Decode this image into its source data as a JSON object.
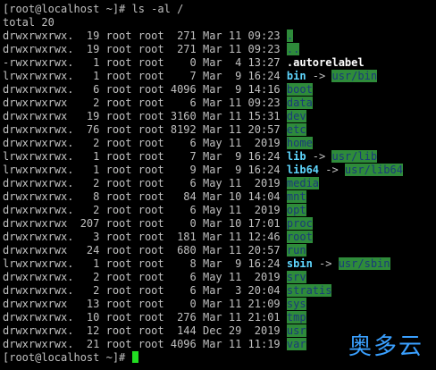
{
  "prompt1": "[root@localhost ~]# ls -al /",
  "total": "total 20",
  "rows": [
    {
      "meta": "drwxrwxrwx.  19 root root  271 Mar 11 09:23 ",
      "name": ".",
      "kind": "dir"
    },
    {
      "meta": "drwxrwxrwx.  19 root root  271 Mar 11 09:23 ",
      "name": "..",
      "kind": "dir"
    },
    {
      "meta": "-rwxrwxrwx.   1 root root    0 Mar  4 13:27 ",
      "name": ".autorelabel",
      "kind": "file"
    },
    {
      "meta": "lrwxrwxrwx.   1 root root    7 Mar  9 16:24 ",
      "name": "bin",
      "kind": "link",
      "target": "usr/bin"
    },
    {
      "meta": "drwxrwxrwx.   6 root root 4096 Mar  9 14:16 ",
      "name": "boot",
      "kind": "dir"
    },
    {
      "meta": "drwxrwxrwx    2 root root    6 Mar 11 09:23 ",
      "name": "data",
      "kind": "dir"
    },
    {
      "meta": "drwxrwxrwx   19 root root 3160 Mar 11 15:31 ",
      "name": "dev",
      "kind": "dir"
    },
    {
      "meta": "drwxrwxrwx.  76 root root 8192 Mar 11 20:57 ",
      "name": "etc",
      "kind": "dir"
    },
    {
      "meta": "drwxrwxrwx.   2 root root    6 May 11  2019 ",
      "name": "home",
      "kind": "dir"
    },
    {
      "meta": "lrwxrwxrwx.   1 root root    7 Mar  9 16:24 ",
      "name": "lib",
      "kind": "link",
      "target": "usr/lib"
    },
    {
      "meta": "lrwxrwxrwx.   1 root root    9 Mar  9 16:24 ",
      "name": "lib64",
      "kind": "link",
      "target": "usr/lib64"
    },
    {
      "meta": "drwxrwxrwx.   2 root root    6 May 11  2019 ",
      "name": "media",
      "kind": "dir"
    },
    {
      "meta": "drwxrwxrwx.   8 root root   84 Mar 10 14:04 ",
      "name": "mnt",
      "kind": "dir"
    },
    {
      "meta": "drwxrwxrwx.   2 root root    6 May 11  2019 ",
      "name": "opt",
      "kind": "dir"
    },
    {
      "meta": "drwxrwxrwx  207 root root    0 Mar 10 17:01 ",
      "name": "proc",
      "kind": "dir"
    },
    {
      "meta": "drwxrwxrwx.   3 root root  181 Mar 11 12:46 ",
      "name": "root",
      "kind": "dir"
    },
    {
      "meta": "drwxrwxrwx   24 root root  680 Mar 11 20:57 ",
      "name": "run",
      "kind": "dir"
    },
    {
      "meta": "lrwxrwxrwx.   1 root root    8 Mar  9 16:24 ",
      "name": "sbin",
      "kind": "link",
      "target": "usr/sbin"
    },
    {
      "meta": "drwxrwxrwx.   2 root root    6 May 11  2019 ",
      "name": "srv",
      "kind": "dir"
    },
    {
      "meta": "drwxrwxrwx.   2 root root    6 Mar  3 20:04 ",
      "name": "stratis",
      "kind": "dir"
    },
    {
      "meta": "drwxrwxrwx   13 root root    0 Mar 11 21:09 ",
      "name": "sys",
      "kind": "dir"
    },
    {
      "meta": "drwxrwxrwx.  10 root root  276 Mar 11 21:01 ",
      "name": "tmp",
      "kind": "dir"
    },
    {
      "meta": "drwxrwxrwx.  12 root root  144 Dec 29  2019 ",
      "name": "usr",
      "kind": "dir"
    },
    {
      "meta": "drwxrwxrwx.  21 root root 4096 Mar 11 11:19 ",
      "name": "var",
      "kind": "dir"
    }
  ],
  "link_arrow": " -> ",
  "prompt2": "[root@localhost ~]# ",
  "watermark": "奥多云",
  "colors": {
    "background": "#000000",
    "text": "#c0c0c0",
    "dir_highlight": "#2e8b3a",
    "dir_text": "#1b3a7a",
    "link_text": "#5fd7ff",
    "cursor": "#22dd22",
    "watermark": "#3aa0ff"
  }
}
